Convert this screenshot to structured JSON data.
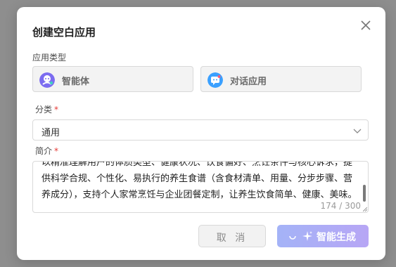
{
  "dialog": {
    "title": "创建空白应用",
    "app_type_label": "应用类型",
    "app_types": [
      {
        "label": "智能体",
        "icon": "robot-avatar-icon",
        "color": "#7c6cf0"
      },
      {
        "label": "对话应用",
        "icon": "chat-bubble-icon",
        "color": "#3aa0ff"
      }
    ],
    "category_label": "分类",
    "category_value": "通用",
    "intro_label": "简介",
    "required_mark": "*",
    "intro_text": "以精准理解用户的体质类型、健康状况、饮食偏好、烹饪条件与核心诉求，提供科学合规、个性化、易执行的养生食谱（含食材清单、用量、分步步骤、营养成分），支持个人家常烹饪与企业团餐定制，让养生饮食简单、健康、美味。",
    "char_count": "174 / 300",
    "cancel_label": "取 消",
    "generate_label": "智能生成"
  },
  "colors": {
    "required": "#e53935",
    "generate_gradient_start": "#a4b3f7",
    "generate_gradient_end": "#b7a6f5"
  }
}
